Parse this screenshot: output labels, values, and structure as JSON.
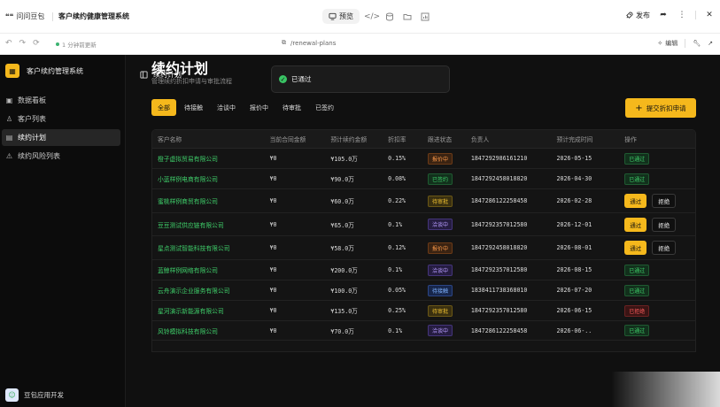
{
  "topbar": {
    "brand": "问问豆包",
    "project_title": "客户续约健康管理系统",
    "preview_label": "预览",
    "publish_label": "发布"
  },
  "addrbar": {
    "saved_text": "1 分钟前更新",
    "url": "/renewal-plans",
    "edit_label": "编辑"
  },
  "sidebar": {
    "brand": "客户续约管理系统",
    "items": [
      {
        "label": "数据看板",
        "icon": "dashboard-icon"
      },
      {
        "label": "客户列表",
        "icon": "users-icon"
      },
      {
        "label": "续约计划",
        "icon": "calendar-icon",
        "active": true
      },
      {
        "label": "续约风险列表",
        "icon": "warning-icon"
      }
    ],
    "footer": "豆包应用开发"
  },
  "header": {
    "title": "续约计划"
  },
  "toast": {
    "text": "已通过"
  },
  "page": {
    "title": "续约计划",
    "subtitle": "管理续约折扣申请与审批流程",
    "submit_label": "提交折扣申请"
  },
  "filters": [
    "全部",
    "待接触",
    "洽谈中",
    "报价中",
    "待审批",
    "已签约"
  ],
  "table": {
    "columns": [
      "客户名称",
      "当前合同金额",
      "预计续约金额",
      "折扣率",
      "跟进状态",
      "负责人",
      "预计完成时间",
      "操作"
    ],
    "pass_label": "通过",
    "reject_label": "拒绝",
    "rows": [
      {
        "customer": "橙子虚拟贸易有限公司",
        "current": "¥0",
        "expected": "¥105.0万",
        "discount": "0.15%",
        "status": "报价中",
        "status_type": "quote",
        "owner": "1847292986161210",
        "due": "2026-05-15",
        "action": "已通过",
        "action_type": "pass"
      },
      {
        "customer": "小蓝样例电商有限公司",
        "current": "¥0",
        "expected": "¥90.0万",
        "discount": "0.08%",
        "status": "已签约",
        "status_type": "signed",
        "owner": "1847292458018820",
        "due": "2026-04-30",
        "action": "已通过",
        "action_type": "pass"
      },
      {
        "customer": "蜜桃样例商贸有限公司",
        "current": "¥0",
        "expected": "¥60.0万",
        "discount": "0.22%",
        "status": "待审批",
        "status_type": "pending",
        "owner": "1847286122258458",
        "due": "2026-02-28",
        "action": "buttons",
        "action_type": "buttons"
      },
      {
        "customer": "豆豆测试供应链有限公司",
        "current": "¥0",
        "expected": "¥65.0万",
        "discount": "0.1%",
        "status": "洽谈中",
        "status_type": "nego",
        "owner": "1847292357012580",
        "due": "2026-12-01",
        "action": "buttons",
        "action_type": "buttons"
      },
      {
        "customer": "星点测试智能科技有限公司",
        "current": "¥0",
        "expected": "¥58.0万",
        "discount": "0.12%",
        "status": "报价中",
        "status_type": "quote",
        "owner": "1847292458018820",
        "due": "2026-08-01",
        "action": "buttons",
        "action_type": "buttons"
      },
      {
        "customer": "蓝鲸样例网络有限公司",
        "current": "¥0",
        "expected": "¥200.0万",
        "discount": "0.1%",
        "status": "洽谈中",
        "status_type": "nego",
        "owner": "1847292357012580",
        "due": "2026-08-15",
        "action": "已通过",
        "action_type": "pass"
      },
      {
        "customer": "云舟演示企业服务有限公司",
        "current": "¥0",
        "expected": "¥100.0万",
        "discount": "0.05%",
        "status": "待接触",
        "status_type": "wait",
        "owner": "1838411738368010",
        "due": "2026-07-20",
        "action": "已通过",
        "action_type": "pass"
      },
      {
        "customer": "星河演示新能源有限公司",
        "current": "¥0",
        "expected": "¥135.0万",
        "discount": "0.25%",
        "status": "待审批",
        "status_type": "pending",
        "owner": "1847292357012580",
        "due": "2026-06-15",
        "action": "已拒绝",
        "action_type": "reject"
      },
      {
        "customer": "风铃模拟科技有限公司",
        "current": "¥0",
        "expected": "¥70.0万",
        "discount": "0.1%",
        "status": "洽谈中",
        "status_type": "nego",
        "owner": "1847286122258458",
        "due": "2026-06-..",
        "action": "已通过",
        "action_type": "pass"
      }
    ]
  }
}
